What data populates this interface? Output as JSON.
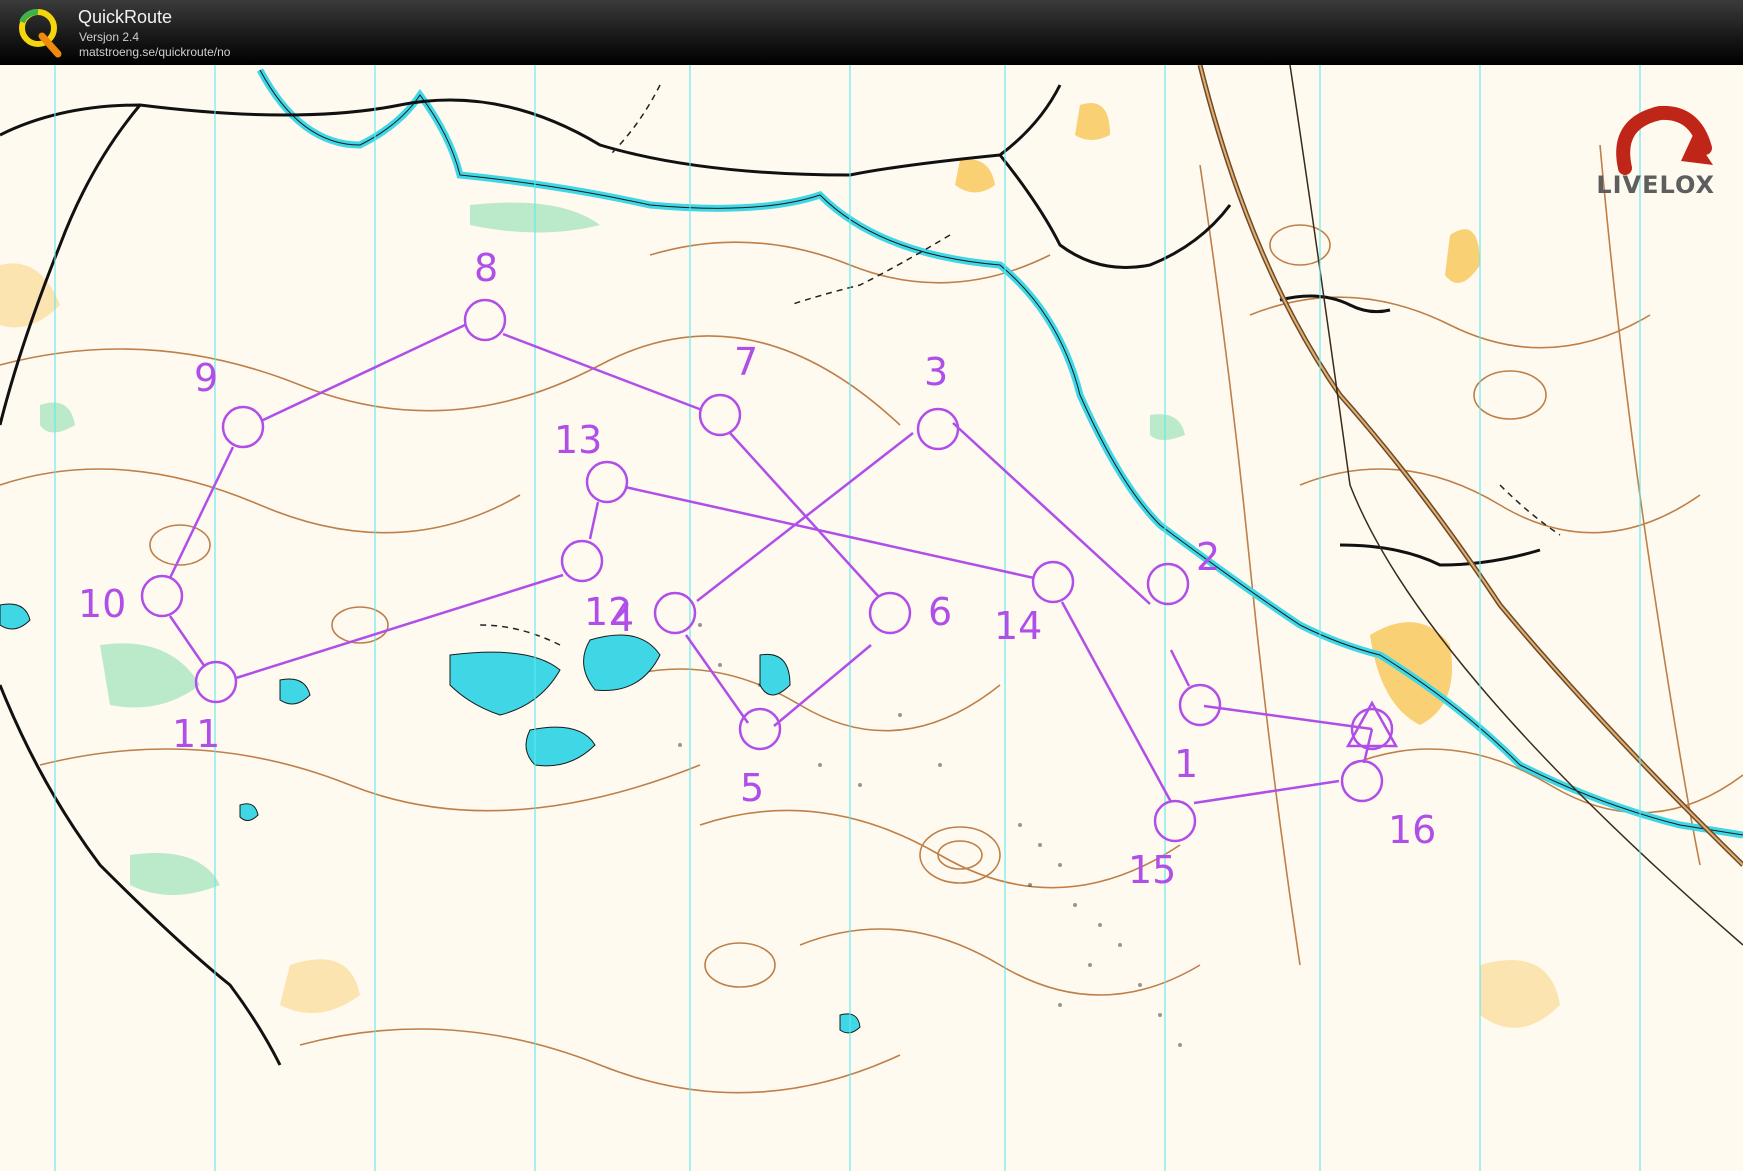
{
  "window": {
    "title": "QuickRoute",
    "version": "Versjon 2.4",
    "url": "matstroeng.se/quickroute/no",
    "logo_icon": "quickroute-q-logo-icon"
  },
  "branding": {
    "watermark": "LIVELOX",
    "watermark_icon": "livelox-arrow-icon"
  },
  "colors": {
    "course": "#b04ee8",
    "water": "#3fd6e6",
    "contour": "#b3692b",
    "road": "#000000",
    "paper": "#fffaf0",
    "open_land": "#f5b730",
    "green": "#8ee0b0",
    "north_lines": "#5ee8ee"
  },
  "course": {
    "controls": [
      {
        "label": "",
        "type": "start"
      },
      {
        "label": "1"
      },
      {
        "label": "2"
      },
      {
        "label": "3"
      },
      {
        "label": "4"
      },
      {
        "label": "5"
      },
      {
        "label": "6"
      },
      {
        "label": "7"
      },
      {
        "label": "8"
      },
      {
        "label": "9"
      },
      {
        "label": "10"
      },
      {
        "label": "11"
      },
      {
        "label": "12"
      },
      {
        "label": "13"
      },
      {
        "label": "14"
      },
      {
        "label": "15"
      },
      {
        "label": "16"
      }
    ]
  }
}
